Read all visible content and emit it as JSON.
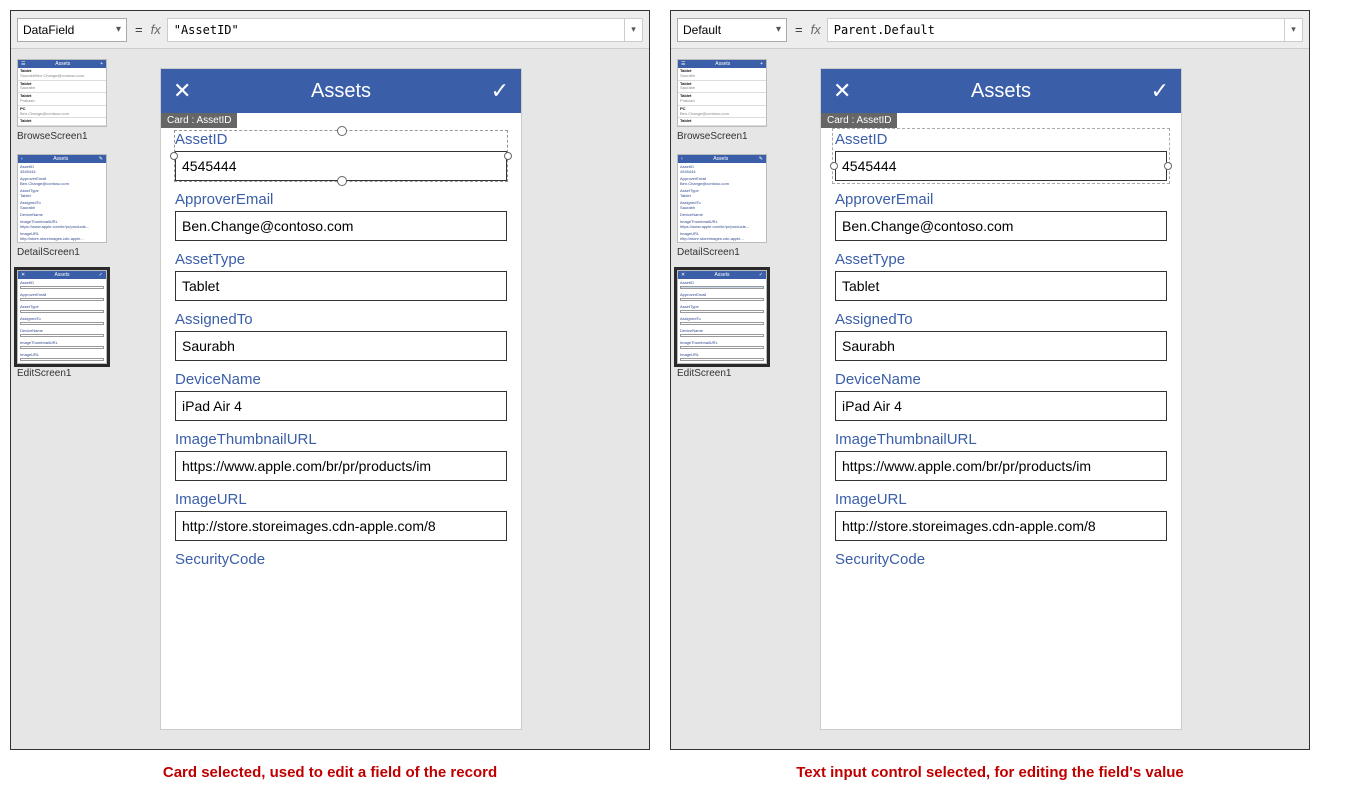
{
  "left": {
    "property_name": "DataField",
    "formula": "\"AssetID\"",
    "badge": "Card : AssetID",
    "selection_mode": "card"
  },
  "right": {
    "property_name": "Default",
    "formula": "Parent.Default",
    "badge": "Card : AssetID",
    "selection_mode": "input"
  },
  "phone": {
    "title": "Assets",
    "fields": [
      {
        "label": "AssetID",
        "value": "4545444"
      },
      {
        "label": "ApproverEmail",
        "value": "Ben.Change@contoso.com"
      },
      {
        "label": "AssetType",
        "value": "Tablet"
      },
      {
        "label": "AssignedTo",
        "value": "Saurabh"
      },
      {
        "label": "DeviceName",
        "value": "iPad Air 4"
      },
      {
        "label": "ImageThumbnailURL",
        "value": "https://www.apple.com/br/pr/products/im"
      },
      {
        "label": "ImageURL",
        "value": "http://store.storeimages.cdn-apple.com/8"
      },
      {
        "label": "SecurityCode",
        "value": ""
      }
    ]
  },
  "thumbnails": [
    {
      "label": "BrowseScreen1"
    },
    {
      "label": "DetailScreen1"
    },
    {
      "label": "EditScreen1"
    }
  ],
  "thumb_browse_title": "Assets",
  "thumb_rows": [
    "Tablet",
    "Tablet",
    "Tablet",
    "PC",
    "Tablet"
  ],
  "thumb_detail_fields": [
    "AssetID",
    "ApproverEmail",
    "AssetType",
    "AssignedTo",
    "DeviceName",
    "ImageThumbnailURL",
    "ImageURL"
  ],
  "captions": {
    "left": "Card selected, used to edit a field of the record",
    "right": "Text input control selected, for editing the field's value"
  },
  "glyphs": {
    "x": "✕",
    "check": "✓",
    "chev": "▾",
    "fx": "fx",
    "eq": "="
  }
}
